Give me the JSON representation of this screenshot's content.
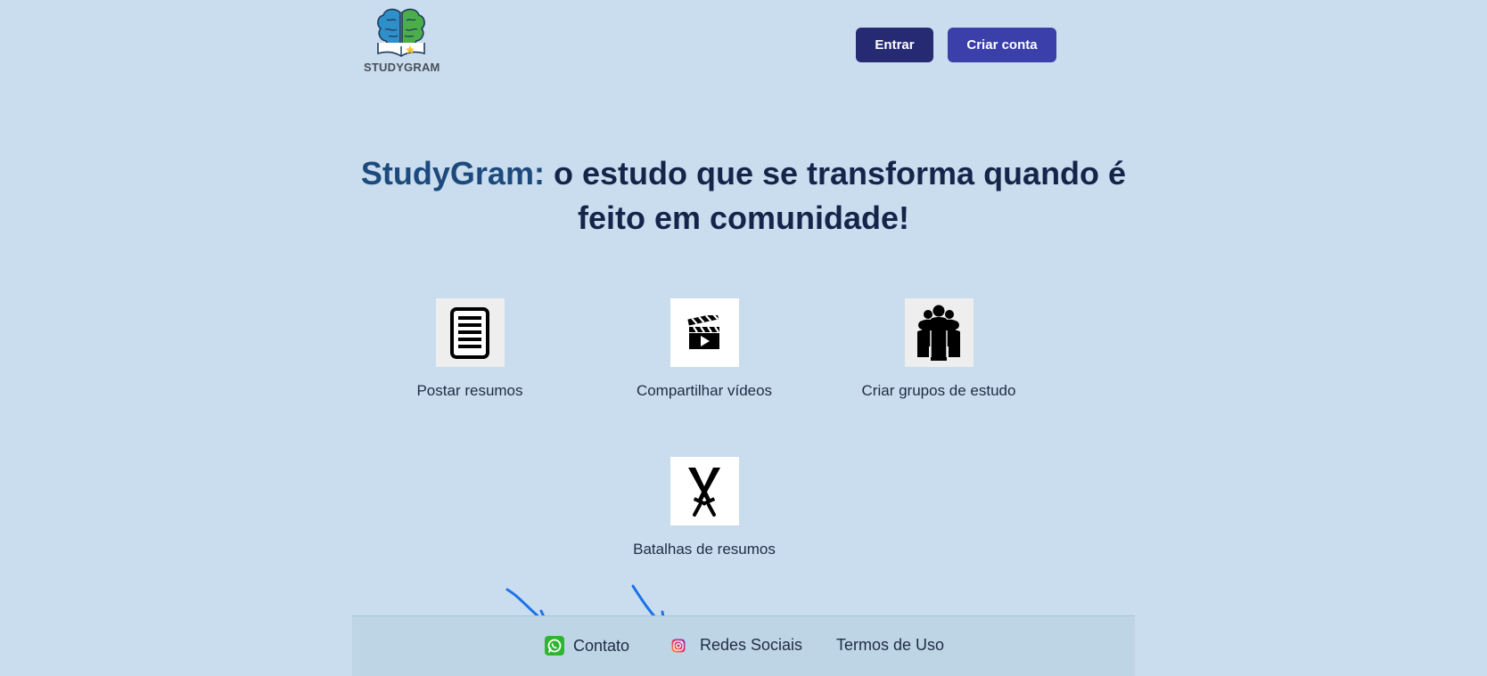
{
  "header": {
    "logo_text": "STUDYGRAM",
    "login_label": "Entrar",
    "signup_label": "Criar conta"
  },
  "hero": {
    "brand": "StudyGram:",
    "tagline": " o estudo que se transforma quando é feito em comunidade!"
  },
  "features": [
    {
      "label": "Postar resumos",
      "icon": "document-icon"
    },
    {
      "label": "Compartilhar vídeos",
      "icon": "clapperboard-icon"
    },
    {
      "label": "Criar grupos de estudo",
      "icon": "group-icon"
    },
    {
      "label": "Batalhas de resumos",
      "icon": "crossed-swords-icon"
    }
  ],
  "footer": {
    "contact_label": "Contato",
    "social_label": "Redes Sociais",
    "terms_label": "Termos de Uso"
  },
  "colors": {
    "background": "#c9ddef",
    "login_button": "#262a72",
    "signup_button": "#3a3fa9",
    "brand_text": "#1d4a7d",
    "annotation_arrow": "#1a73e8",
    "whatsapp_green": "#2fb52f"
  }
}
